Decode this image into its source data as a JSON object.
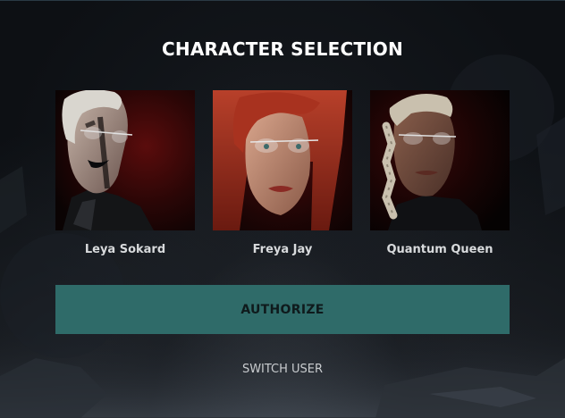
{
  "header": {
    "title": "CHARACTER SELECTION"
  },
  "characters": [
    {
      "name": "Leya Sokard",
      "icon": "portrait-leya-sokard"
    },
    {
      "name": "Freya Jay",
      "icon": "portrait-freya-jay"
    },
    {
      "name": "Quantum Queen",
      "icon": "portrait-quantum-queen"
    }
  ],
  "actions": {
    "authorize_label": "AUTHORIZE",
    "switch_user_label": "SWITCH USER"
  },
  "colors": {
    "accent": "#2f6b69",
    "background": "#0d1014",
    "title": "#ffffff"
  }
}
